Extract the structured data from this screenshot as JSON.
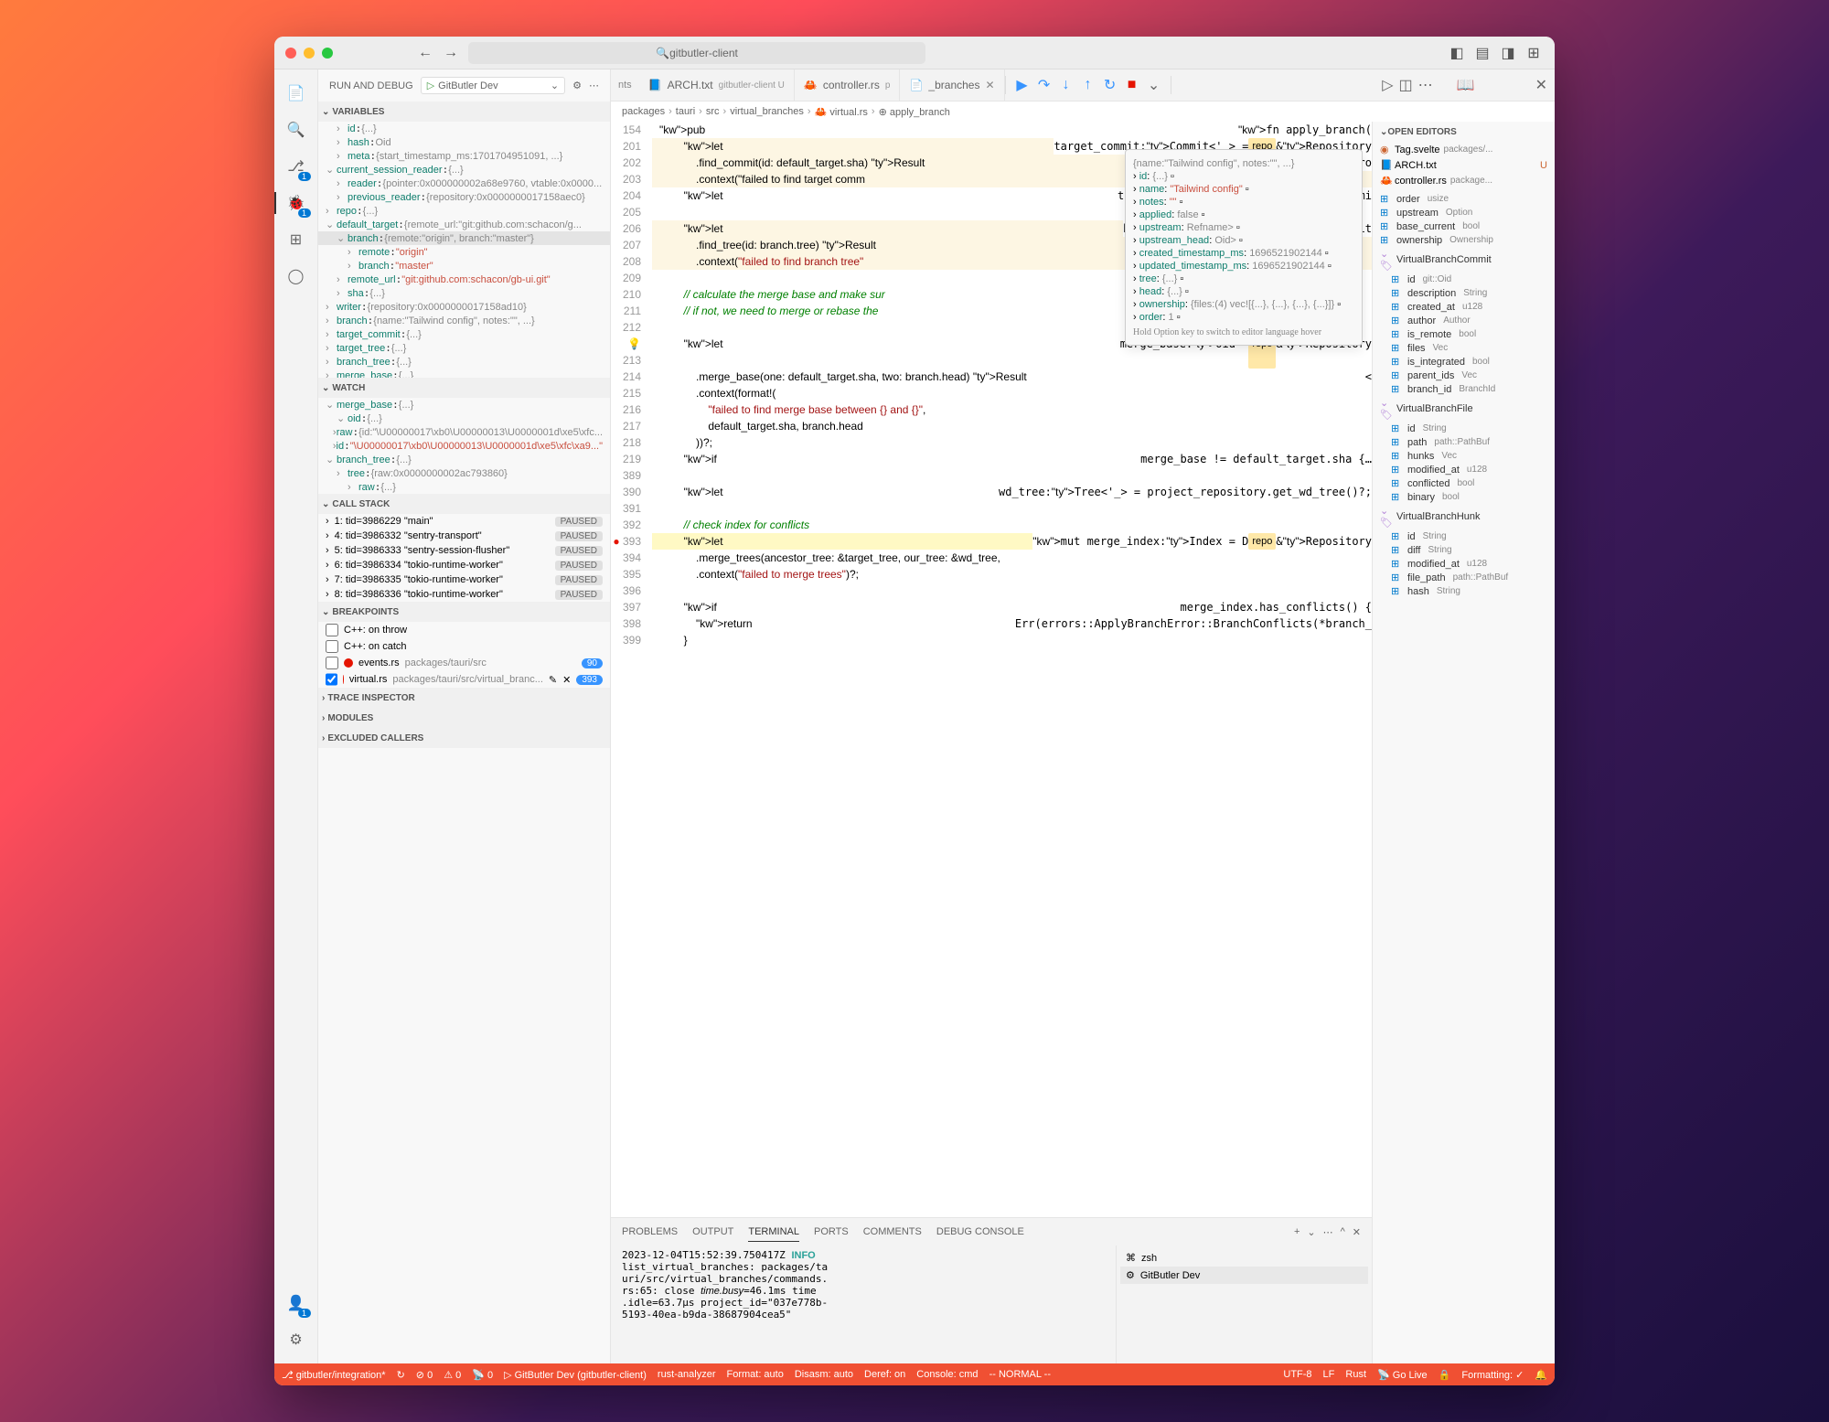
{
  "window": {
    "search": "gitbutler-client"
  },
  "sidebar": {
    "title": "RUN AND DEBUG",
    "launch_config": "GitButler Dev",
    "sections": {
      "variables": "VARIABLES",
      "watch": "WATCH",
      "callstack": "CALL STACK",
      "breakpoints": "BREAKPOINTS",
      "trace_inspector": "TRACE INSPECTOR",
      "modules": "MODULES",
      "excluded_callers": "EXCLUDED CALLERS"
    },
    "variables": [
      {
        "indent": 1,
        "key": "id",
        "val": "{...}"
      },
      {
        "indent": 1,
        "key": "hash",
        "val": "Oid"
      },
      {
        "indent": 1,
        "key": "meta",
        "val": "{start_timestamp_ms:1701704951091, ...}"
      },
      {
        "indent": 0,
        "key": "current_session_reader",
        "val": "{...}",
        "open": true
      },
      {
        "indent": 1,
        "key": "reader",
        "val": "{pointer:0x000000002a68e9760, vtable:0x0000..."
      },
      {
        "indent": 1,
        "key": "previous_reader",
        "val": "{repository:0x0000000017158aec0}"
      },
      {
        "indent": 0,
        "key": "repo",
        "val": "{...}"
      },
      {
        "indent": 0,
        "key": "default_target",
        "val": "{remote_url:\"git:github.com:schacon/g...",
        "open": true
      },
      {
        "indent": 1,
        "key": "branch",
        "val": "{remote:\"origin\", branch:\"master\"}",
        "open": true,
        "selected": true
      },
      {
        "indent": 2,
        "key": "remote",
        "val": "\"origin\"",
        "isstr": true
      },
      {
        "indent": 2,
        "key": "branch",
        "val": "\"master\"",
        "isstr": true
      },
      {
        "indent": 1,
        "key": "remote_url",
        "val": "\"git:github.com:schacon/gb-ui.git\"",
        "isstr": true
      },
      {
        "indent": 1,
        "key": "sha",
        "val": "{...}"
      },
      {
        "indent": 0,
        "key": "writer",
        "val": "{repository:0x0000000017158ad10}"
      },
      {
        "indent": 0,
        "key": "branch",
        "val": "{name:\"Tailwind config\", notes:\"\", ...}"
      },
      {
        "indent": 0,
        "key": "target_commit",
        "val": "{...}"
      },
      {
        "indent": 0,
        "key": "target_tree",
        "val": "{...}"
      },
      {
        "indent": 0,
        "key": "branch_tree",
        "val": "{...}"
      },
      {
        "indent": 0,
        "key": "merge_base",
        "val": "{...}"
      }
    ],
    "watch": [
      {
        "indent": 0,
        "key": "merge_base",
        "val": "{...}",
        "open": true
      },
      {
        "indent": 1,
        "key": "oid",
        "val": "{...}",
        "open": true
      },
      {
        "indent": 2,
        "key": "raw",
        "val": "{id:\"\\U00000017\\xb0\\U00000013\\U0000001d\\xe5\\xfc..."
      },
      {
        "indent": 3,
        "key": "id",
        "val": "\"\\U00000017\\xb0\\U00000013\\U0000001d\\xe5\\xfc\\xa9...\"",
        "isstr": true
      },
      {
        "indent": 0,
        "key": "branch_tree",
        "val": "{...}",
        "open": true
      },
      {
        "indent": 1,
        "key": "tree",
        "val": "{raw:0x0000000002ac793860}"
      },
      {
        "indent": 2,
        "key": "raw",
        "val": "{...}"
      }
    ],
    "callstack": [
      {
        "label": "1: tid=3986229 \"main\"",
        "tag": "PAUSED"
      },
      {
        "label": "4: tid=3986332 \"sentry-transport\"",
        "tag": "PAUSED"
      },
      {
        "label": "5: tid=3986333 \"sentry-session-flusher\"",
        "tag": "PAUSED"
      },
      {
        "label": "6: tid=3986334 \"tokio-runtime-worker\"",
        "tag": "PAUSED"
      },
      {
        "label": "7: tid=3986335 \"tokio-runtime-worker\"",
        "tag": "PAUSED"
      },
      {
        "label": "8: tid=3986336 \"tokio-runtime-worker\"",
        "tag": "PAUSED"
      }
    ],
    "breakpoints": [
      {
        "checked": false,
        "label": "C++: on throw"
      },
      {
        "checked": false,
        "label": "C++: on catch"
      },
      {
        "checked": false,
        "label": "events.rs",
        "path": "packages/tauri/src",
        "badge": "90",
        "dot": true
      },
      {
        "checked": true,
        "label": "virtual.rs",
        "path": "packages/tauri/src/virtual_branc...",
        "badge": "393",
        "dot": true,
        "editable": true
      }
    ]
  },
  "tabs": [
    {
      "label": "ARCH.txt",
      "desc": "gitbutler-client U",
      "icon": "📘"
    },
    {
      "label": "controller.rs",
      "desc": "p",
      "icon": "🦀"
    },
    {
      "label": "_branches",
      "close": true
    }
  ],
  "breadcrumb": [
    "packages",
    "tauri",
    "src",
    "virtual_branches",
    "virtual.rs",
    "apply_branch"
  ],
  "code": [
    {
      "n": 154,
      "t": "pub fn apply_branch(",
      "cls": ""
    },
    {
      "n": 201,
      "t": "        let target_commit: Commit<'_> = repo &Repository",
      "hl": true
    },
    {
      "n": 202,
      "t": "            .find_commit(id: default_target.sha) Result<Commit<'_>, Erro",
      "hl": true
    },
    {
      "n": 203,
      "t": "            .context(\"failed to find target comm",
      "hl": true
    },
    {
      "n": 204,
      "t": "        let target_tree: Tree<'_> = target_commi"
    },
    {
      "n": 205,
      "t": ""
    },
    {
      "n": 206,
      "t": "        let branch_tree: Tree<'_> = repo &Reposit",
      "hl": true
    },
    {
      "n": 207,
      "t": "            .find_tree(id: branch.tree) Result<Tr",
      "hl": true
    },
    {
      "n": 208,
      "t": "            .context(\"failed to find branch tree\"",
      "hl": true
    },
    {
      "n": 209,
      "t": ""
    },
    {
      "n": 210,
      "t": "        // calculate the merge base and make sur",
      "cmt": true
    },
    {
      "n": 211,
      "t": "        // if not, we need to merge or rebase the",
      "cmt": true
    },
    {
      "n": 212,
      "t": ""
    },
    {
      "n": 213,
      "t": "        let merge_base: Oid = repo &Repository",
      "cur": true
    },
    {
      "n": 214,
      "t": "            .merge_base(one: default_target.sha, two: branch.head) Result<"
    },
    {
      "n": 215,
      "t": "            .context(format!("
    },
    {
      "n": 216,
      "t": "                \"failed to find merge base between {} and {}\","
    },
    {
      "n": 217,
      "t": "                default_target.sha, branch.head"
    },
    {
      "n": 218,
      "t": "            ))?;"
    },
    {
      "n": 219,
      "t": "        if merge_base != default_target.sha {…"
    },
    {
      "n": 389,
      "t": ""
    },
    {
      "n": 390,
      "t": "        let wd_tree: Tree<'_> = project_repository.get_wd_tree()?;"
    },
    {
      "n": 391,
      "t": ""
    },
    {
      "n": 392,
      "t": "        // check index for conflicts",
      "cmt": true
    },
    {
      "n": 393,
      "t": "        let mut merge_index: Index = D repo &Repository",
      "hl2": true,
      "bp": true
    },
    {
      "n": 394,
      "t": "            .merge_trees(ancestor_tree: &target_tree, our_tree: &wd_tree,"
    },
    {
      "n": 395,
      "t": "            .context(\"failed to merge trees\")?;"
    },
    {
      "n": 396,
      "t": ""
    },
    {
      "n": 397,
      "t": "        if merge_index.has_conflicts() {"
    },
    {
      "n": 398,
      "t": "            return Err(errors::ApplyBranchError::BranchConflicts(*branch_"
    },
    {
      "n": 399,
      "t": "        }"
    }
  ],
  "hover": {
    "header": "{name:\"Tailwind config\", notes:\"\", ...}",
    "rows": [
      {
        "k": "id",
        "v": "{...}"
      },
      {
        "k": "name",
        "v": "\"Tailwind config\"",
        "str": true
      },
      {
        "k": "notes",
        "v": "\"\"",
        "str": true
      },
      {
        "k": "applied",
        "v": "false"
      },
      {
        "k": "upstream",
        "v": "Refname>"
      },
      {
        "k": "upstream_head",
        "v": "Oid>"
      },
      {
        "k": "created_timestamp_ms",
        "v": "1696521902144"
      },
      {
        "k": "updated_timestamp_ms",
        "v": "1696521902144"
      },
      {
        "k": "tree",
        "v": "{...}"
      },
      {
        "k": "head",
        "v": "{...}"
      },
      {
        "k": "ownership",
        "v": "{files:(4) vec![{...}, {...}, {...}, {...}]}"
      },
      {
        "k": "order",
        "v": "1"
      }
    ],
    "footer": "Hold Option key to switch to editor language hover"
  },
  "panel": {
    "tabs": [
      "PROBLEMS",
      "OUTPUT",
      "TERMINAL",
      "PORTS",
      "COMMENTS",
      "DEBUG CONSOLE"
    ],
    "active_tab": "TERMINAL",
    "terminal_output": "2023-12-04T15:52:39.750417Z  INFO\nlist_virtual_branches: packages/ta\nuri/src/virtual_branches/commands.\nrs:65: close time.busy=46.1ms time\n.idle=63.7µs project_id=\"037e778b-\n5193-40ea-b9da-38687904cea5\"",
    "terminals": [
      {
        "icon": "⌘",
        "label": "zsh"
      },
      {
        "icon": "⚙",
        "label": "GitButler Dev",
        "active": true
      }
    ]
  },
  "outline": {
    "open_editors_title": "OPEN EDITORS",
    "open_editors": [
      {
        "icon": "◉",
        "name": "Tag.svelte",
        "path": "packages/..."
      },
      {
        "icon": "📘",
        "name": "ARCH.txt",
        "status": "U"
      },
      {
        "icon": "🦀",
        "name": "controller.rs",
        "path": "package..."
      }
    ],
    "items": [
      {
        "k": "order",
        "t": "usize",
        "i": "field"
      },
      {
        "k": "upstream",
        "t": "Option<Rem...",
        "i": "field"
      },
      {
        "k": "base_current",
        "t": "bool",
        "i": "field"
      },
      {
        "k": "ownership",
        "t": "Ownership",
        "i": "field"
      },
      {
        "k": "VirtualBranchCommit",
        "t": "",
        "i": "struct",
        "open": true
      },
      {
        "k": "id",
        "t": "git::Oid",
        "i": "field",
        "indent": 1
      },
      {
        "k": "description",
        "t": "String",
        "i": "field",
        "indent": 1
      },
      {
        "k": "created_at",
        "t": "u128",
        "i": "field",
        "indent": 1
      },
      {
        "k": "author",
        "t": "Author",
        "i": "field",
        "indent": 1
      },
      {
        "k": "is_remote",
        "t": "bool",
        "i": "field",
        "indent": 1
      },
      {
        "k": "files",
        "t": "Vec<VirtualBranc...",
        "i": "field",
        "indent": 1
      },
      {
        "k": "is_integrated",
        "t": "bool",
        "i": "field",
        "indent": 1
      },
      {
        "k": "parent_ids",
        "t": "Vec<git::Oi...",
        "i": "field",
        "indent": 1
      },
      {
        "k": "branch_id",
        "t": "BranchId",
        "i": "field",
        "indent": 1
      },
      {
        "k": "VirtualBranchFile",
        "t": "",
        "i": "struct",
        "open": true
      },
      {
        "k": "id",
        "t": "String",
        "i": "field",
        "indent": 1
      },
      {
        "k": "path",
        "t": "path::PathBuf",
        "i": "field",
        "indent": 1
      },
      {
        "k": "hunks",
        "t": "Vec<VirtualBran...",
        "i": "field",
        "indent": 1
      },
      {
        "k": "modified_at",
        "t": "u128",
        "i": "field",
        "indent": 1
      },
      {
        "k": "conflicted",
        "t": "bool",
        "i": "field",
        "indent": 1
      },
      {
        "k": "binary",
        "t": "bool",
        "i": "field",
        "indent": 1
      },
      {
        "k": "VirtualBranchHunk",
        "t": "",
        "i": "struct",
        "open": true
      },
      {
        "k": "id",
        "t": "String",
        "i": "field",
        "indent": 1
      },
      {
        "k": "diff",
        "t": "String",
        "i": "field",
        "indent": 1
      },
      {
        "k": "modified_at",
        "t": "u128",
        "i": "field",
        "indent": 1
      },
      {
        "k": "file_path",
        "t": "path::PathBuf",
        "i": "field",
        "indent": 1
      },
      {
        "k": "hash",
        "t": "String",
        "i": "field",
        "indent": 1
      }
    ]
  },
  "statusbar": {
    "left": [
      {
        "icon": "⎇",
        "label": "gitbutler/integration*"
      },
      {
        "icon": "↻",
        "label": ""
      },
      {
        "icon": "⊘",
        "label": "0"
      },
      {
        "icon": "⚠",
        "label": "0"
      },
      {
        "icon": "📡",
        "label": "0"
      },
      {
        "icon": "▷",
        "label": "GitButler Dev (gitbutler-client)"
      },
      {
        "label": "rust-analyzer"
      },
      {
        "label": "Format: auto"
      },
      {
        "label": "Disasm: auto"
      },
      {
        "label": "Deref: on"
      },
      {
        "label": "Console: cmd"
      },
      {
        "label": "-- NORMAL --"
      }
    ],
    "right": [
      {
        "label": "UTF-8"
      },
      {
        "label": "LF"
      },
      {
        "label": "Rust"
      },
      {
        "icon": "📡",
        "label": "Go Live"
      },
      {
        "icon": "🔒",
        "label": ""
      },
      {
        "label": "Formatting: ✓"
      },
      {
        "icon": "🔔",
        "label": ""
      }
    ]
  }
}
